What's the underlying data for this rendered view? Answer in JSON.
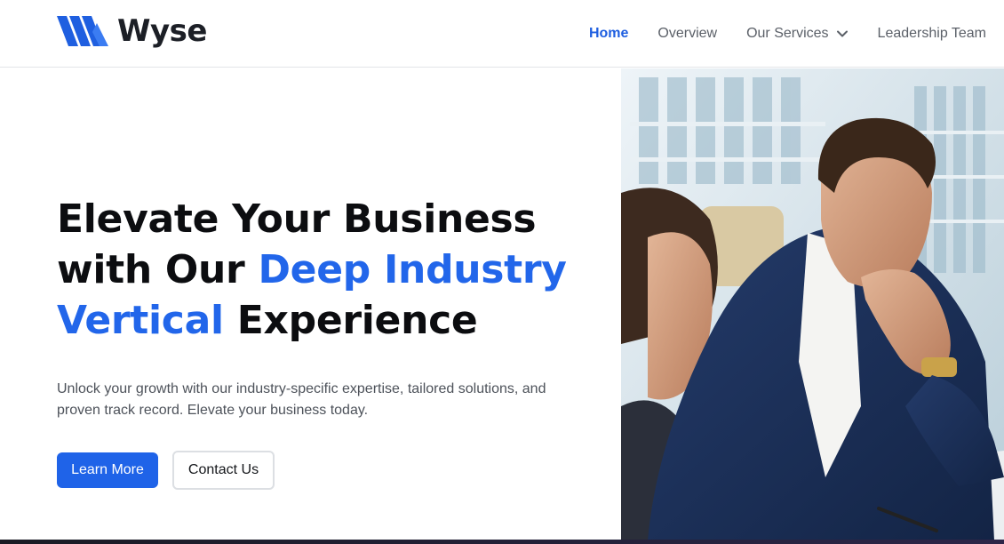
{
  "brand": {
    "name": "Wyse",
    "accent_color": "#2266ea",
    "logo_icon": "wyse-logo-mark"
  },
  "nav": {
    "items": [
      {
        "label": "Home",
        "active": true
      },
      {
        "label": "Overview",
        "active": false
      },
      {
        "label": "Our Services",
        "active": false,
        "icon": "chevron-down-icon"
      },
      {
        "label": "Leadership Team",
        "active": false
      }
    ]
  },
  "hero": {
    "headline": {
      "part1": "Elevate Your Business with Our ",
      "accent": "Deep Industry Vertical",
      "part2": " Experience"
    },
    "subtext": "Unlock your growth with our industry-specific expertise, tailored solutions, and proven track record. Elevate your business today.",
    "primary_button": "Learn More",
    "secondary_button": "Contact Us"
  }
}
